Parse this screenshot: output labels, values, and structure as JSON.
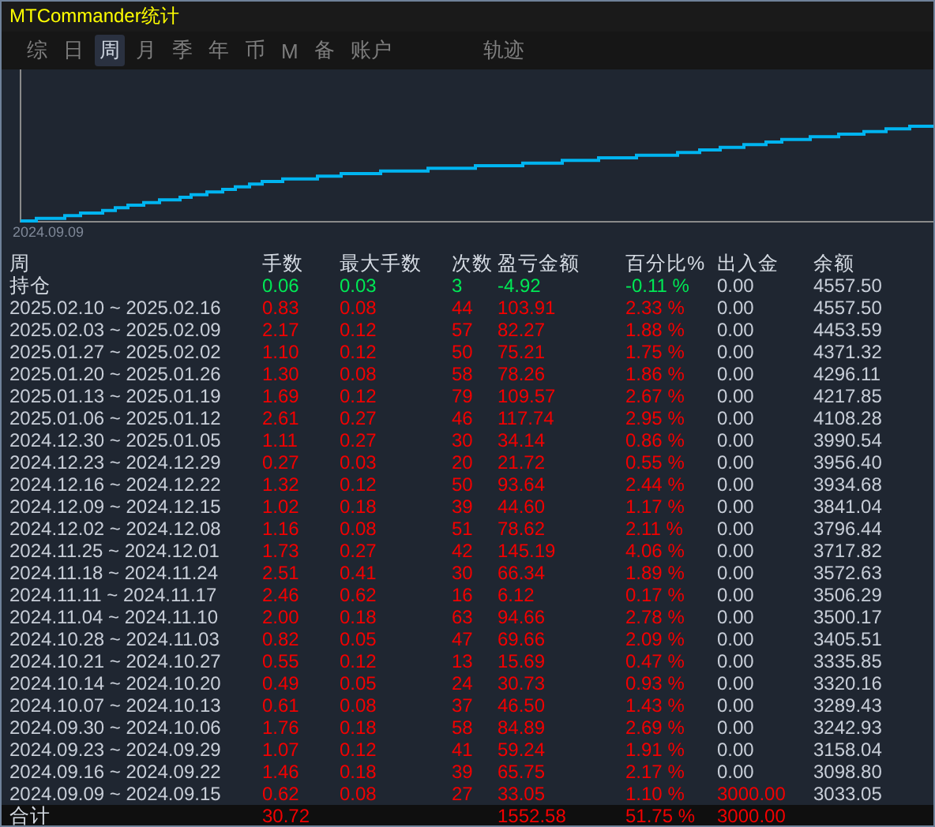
{
  "window": {
    "title": "MTCommander统计"
  },
  "tabs": [
    {
      "label": "综",
      "selected": false
    },
    {
      "label": "日",
      "selected": false
    },
    {
      "label": "周",
      "selected": true
    },
    {
      "label": "月",
      "selected": false
    },
    {
      "label": "季",
      "selected": false
    },
    {
      "label": "年",
      "selected": false
    },
    {
      "label": "币",
      "selected": false
    },
    {
      "label": "M",
      "selected": false
    },
    {
      "label": "备",
      "selected": false
    },
    {
      "label": "账户",
      "selected": false
    },
    {
      "label": "轨迹",
      "selected": false
    }
  ],
  "chart": {
    "start_label": "2024.09.09"
  },
  "table": {
    "columns": [
      "周",
      "手数",
      "最大手数",
      "次数",
      "盈亏金额",
      "百分比%",
      "出入金",
      "余额"
    ],
    "open_position": {
      "label": "持仓",
      "color": "#00e855",
      "lots": "0.06",
      "max_lots": "0.03",
      "count": "3",
      "pnl": "-4.92",
      "pct": "-0.11 %",
      "flow": "0.00",
      "balance": "4557.50"
    },
    "rows": [
      {
        "period": "2025.02.10 ~ 2025.02.16",
        "color": "#f20000",
        "lots": "0.83",
        "max_lots": "0.08",
        "count": "44",
        "pnl": "103.91",
        "pct": "2.33 %",
        "flow": "0.00",
        "deposit": false,
        "balance": "4557.50"
      },
      {
        "period": "2025.02.03 ~ 2025.02.09",
        "color": "#f20000",
        "lots": "2.17",
        "max_lots": "0.12",
        "count": "57",
        "pnl": "82.27",
        "pct": "1.88 %",
        "flow": "0.00",
        "deposit": false,
        "balance": "4453.59"
      },
      {
        "period": "2025.01.27 ~ 2025.02.02",
        "color": "#f20000",
        "lots": "1.10",
        "max_lots": "0.12",
        "count": "50",
        "pnl": "75.21",
        "pct": "1.75 %",
        "flow": "0.00",
        "deposit": false,
        "balance": "4371.32"
      },
      {
        "period": "2025.01.20 ~ 2025.01.26",
        "color": "#f20000",
        "lots": "1.30",
        "max_lots": "0.08",
        "count": "58",
        "pnl": "78.26",
        "pct": "1.86 %",
        "flow": "0.00",
        "deposit": false,
        "balance": "4296.11"
      },
      {
        "period": "2025.01.13 ~ 2025.01.19",
        "color": "#f20000",
        "lots": "1.69",
        "max_lots": "0.12",
        "count": "79",
        "pnl": "109.57",
        "pct": "2.67 %",
        "flow": "0.00",
        "deposit": false,
        "balance": "4217.85"
      },
      {
        "period": "2025.01.06 ~ 2025.01.12",
        "color": "#f20000",
        "lots": "2.61",
        "max_lots": "0.27",
        "count": "46",
        "pnl": "117.74",
        "pct": "2.95 %",
        "flow": "0.00",
        "deposit": false,
        "balance": "4108.28"
      },
      {
        "period": "2024.12.30 ~ 2025.01.05",
        "color": "#f20000",
        "lots": "1.11",
        "max_lots": "0.27",
        "count": "30",
        "pnl": "34.14",
        "pct": "0.86 %",
        "flow": "0.00",
        "deposit": false,
        "balance": "3990.54"
      },
      {
        "period": "2024.12.23 ~ 2024.12.29",
        "color": "#f20000",
        "lots": "0.27",
        "max_lots": "0.03",
        "count": "20",
        "pnl": "21.72",
        "pct": "0.55 %",
        "flow": "0.00",
        "deposit": false,
        "balance": "3956.40"
      },
      {
        "period": "2024.12.16 ~ 2024.12.22",
        "color": "#f20000",
        "lots": "1.32",
        "max_lots": "0.12",
        "count": "50",
        "pnl": "93.64",
        "pct": "2.44 %",
        "flow": "0.00",
        "deposit": false,
        "balance": "3934.68"
      },
      {
        "period": "2024.12.09 ~ 2024.12.15",
        "color": "#f20000",
        "lots": "1.02",
        "max_lots": "0.18",
        "count": "39",
        "pnl": "44.60",
        "pct": "1.17 %",
        "flow": "0.00",
        "deposit": false,
        "balance": "3841.04"
      },
      {
        "period": "2024.12.02 ~ 2024.12.08",
        "color": "#f20000",
        "lots": "1.16",
        "max_lots": "0.08",
        "count": "51",
        "pnl": "78.62",
        "pct": "2.11 %",
        "flow": "0.00",
        "deposit": false,
        "balance": "3796.44"
      },
      {
        "period": "2024.11.25 ~ 2024.12.01",
        "color": "#f20000",
        "lots": "1.73",
        "max_lots": "0.27",
        "count": "42",
        "pnl": "145.19",
        "pct": "4.06 %",
        "flow": "0.00",
        "deposit": false,
        "balance": "3717.82"
      },
      {
        "period": "2024.11.18 ~ 2024.11.24",
        "color": "#f20000",
        "lots": "2.51",
        "max_lots": "0.41",
        "count": "30",
        "pnl": "66.34",
        "pct": "1.89 %",
        "flow": "0.00",
        "deposit": false,
        "balance": "3572.63"
      },
      {
        "period": "2024.11.11 ~ 2024.11.17",
        "color": "#f20000",
        "lots": "2.46",
        "max_lots": "0.62",
        "count": "16",
        "pnl": "6.12",
        "pct": "0.17 %",
        "flow": "0.00",
        "deposit": false,
        "balance": "3506.29"
      },
      {
        "period": "2024.11.04 ~ 2024.11.10",
        "color": "#f20000",
        "lots": "2.00",
        "max_lots": "0.18",
        "count": "63",
        "pnl": "94.66",
        "pct": "2.78 %",
        "flow": "0.00",
        "deposit": false,
        "balance": "3500.17"
      },
      {
        "period": "2024.10.28 ~ 2024.11.03",
        "color": "#f20000",
        "lots": "0.82",
        "max_lots": "0.05",
        "count": "47",
        "pnl": "69.66",
        "pct": "2.09 %",
        "flow": "0.00",
        "deposit": false,
        "balance": "3405.51"
      },
      {
        "period": "2024.10.21 ~ 2024.10.27",
        "color": "#f20000",
        "lots": "0.55",
        "max_lots": "0.12",
        "count": "13",
        "pnl": "15.69",
        "pct": "0.47 %",
        "flow": "0.00",
        "deposit": false,
        "balance": "3335.85"
      },
      {
        "period": "2024.10.14 ~ 2024.10.20",
        "color": "#f20000",
        "lots": "0.49",
        "max_lots": "0.05",
        "count": "24",
        "pnl": "30.73",
        "pct": "0.93 %",
        "flow": "0.00",
        "deposit": false,
        "balance": "3320.16"
      },
      {
        "period": "2024.10.07 ~ 2024.10.13",
        "color": "#f20000",
        "lots": "0.61",
        "max_lots": "0.08",
        "count": "37",
        "pnl": "46.50",
        "pct": "1.43 %",
        "flow": "0.00",
        "deposit": false,
        "balance": "3289.43"
      },
      {
        "period": "2024.09.30 ~ 2024.10.06",
        "color": "#f20000",
        "lots": "1.76",
        "max_lots": "0.18",
        "count": "58",
        "pnl": "84.89",
        "pct": "2.69 %",
        "flow": "0.00",
        "deposit": false,
        "balance": "3242.93"
      },
      {
        "period": "2024.09.23 ~ 2024.09.29",
        "color": "#f20000",
        "lots": "1.07",
        "max_lots": "0.12",
        "count": "41",
        "pnl": "59.24",
        "pct": "1.91 %",
        "flow": "0.00",
        "deposit": false,
        "balance": "3158.04"
      },
      {
        "period": "2024.09.16 ~ 2024.09.22",
        "color": "#f20000",
        "lots": "1.46",
        "max_lots": "0.18",
        "count": "39",
        "pnl": "65.75",
        "pct": "2.17 %",
        "flow": "0.00",
        "deposit": false,
        "balance": "3098.80"
      },
      {
        "period": "2024.09.09 ~ 2024.09.15",
        "color": "#f20000",
        "lots": "0.62",
        "max_lots": "0.08",
        "count": "27",
        "pnl": "33.05",
        "pct": "1.10 %",
        "flow": "3000.00",
        "deposit": true,
        "balance": "3033.05"
      }
    ],
    "total": {
      "label": "合计",
      "lots": "30.72",
      "pnl": "1552.58",
      "pct": "51.75 %",
      "flow": "3000.00"
    }
  }
}
